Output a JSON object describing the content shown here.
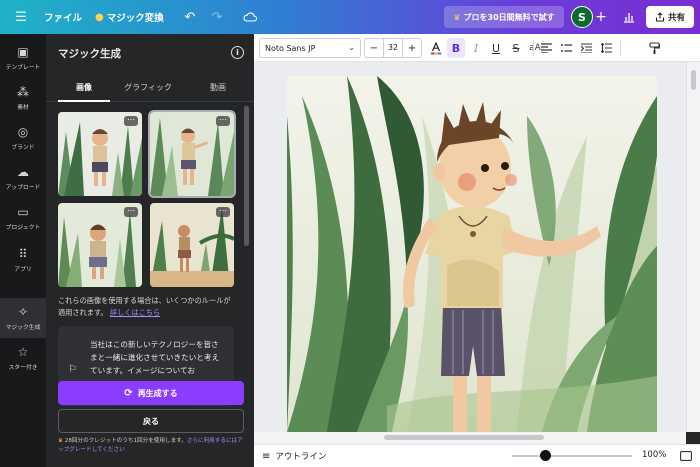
{
  "topbar": {
    "menu_icon": "hamburger-icon",
    "file": "ファイル",
    "magic_change": "マジック変換",
    "pro_trial": "プロを30日間無料で試す",
    "avatar_initial": "S",
    "share": "共有",
    "brand_gradient": [
      "#1fb3c7",
      "#2f7fd3",
      "#6a3cd8",
      "#7a2ed1"
    ]
  },
  "rail": {
    "items": [
      {
        "label": "テンプレート",
        "icon": "template-icon"
      },
      {
        "label": "素材",
        "icon": "elements-icon"
      },
      {
        "label": "ブランド",
        "icon": "brand-icon"
      },
      {
        "label": "アップロード",
        "icon": "upload-icon"
      },
      {
        "label": "プロジェクト",
        "icon": "folder-icon"
      },
      {
        "label": "アプリ",
        "icon": "apps-icon"
      },
      {
        "label": "マジック生成",
        "icon": "magic-generate-icon"
      },
      {
        "label": "スター付き",
        "icon": "star-icon"
      }
    ]
  },
  "panel": {
    "title": "マジック生成",
    "tabs": [
      "画像",
      "グラフィック",
      "動画"
    ],
    "active_tab": "画像",
    "rules_text": "これらの画像を使用する場合は、いくつかのルールが適用されます。",
    "rules_link": "詳しくはこちら",
    "feedback_text": "当社はこの新しいテクノロジーを皆さまと一緒に進化させていきたいと考えています。イメージについてお",
    "regenerate": "再生成する",
    "back": "戻る",
    "credits_text": "28回分のクレジットのうち1回分を使用します。",
    "credits_link": "さらに利用するにはアップグレードしてください",
    "accent": "#8b3dff"
  },
  "toolbar": {
    "font": "Noto Sans JP",
    "font_size": "32",
    "minus": "−",
    "plus": "+"
  },
  "footer": {
    "outline": "アウトライン",
    "zoom": "100%"
  }
}
